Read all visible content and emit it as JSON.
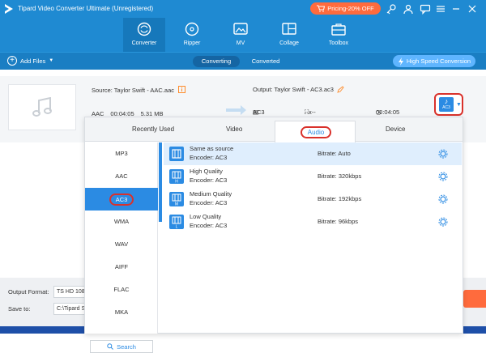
{
  "app": {
    "title": "Tipard Video Converter Ultimate (Unregistered)",
    "promo_label": "Pricing-20% OFF"
  },
  "toolbar": {
    "tools": [
      {
        "label": "Converter",
        "icon": "converter-icon"
      },
      {
        "label": "Ripper",
        "icon": "ripper-icon"
      },
      {
        "label": "MV",
        "icon": "mv-icon"
      },
      {
        "label": "Collage",
        "icon": "collage-icon"
      },
      {
        "label": "Toolbox",
        "icon": "toolbox-icon"
      }
    ]
  },
  "subbar": {
    "add_files": "Add Files",
    "converting": "Converting",
    "converted": "Converted",
    "high_speed": "High Speed Conversion"
  },
  "file": {
    "source": "Source: Taylor Swift - AAC.aac",
    "src_format": "AAC",
    "src_duration": "00:04:05",
    "src_size": "5.31 MB",
    "output": "Output: Taylor Swift - AC3.ac3",
    "out_format": "AC3",
    "out_resolution": "--x--",
    "out_duration": "00:04:05",
    "format_badge": "AC3"
  },
  "dropdown": {
    "tabs": [
      "Recently Used",
      "Video",
      "Audio",
      "Device"
    ],
    "active_tab": "Audio",
    "formats": [
      "MP3",
      "AAC",
      "AC3",
      "WMA",
      "WAV",
      "AIFF",
      "FLAC",
      "MKA"
    ],
    "selected_format": "AC3",
    "search_label": "Search",
    "options": [
      {
        "name": "Same as source",
        "encoder": "Encoder: AC3",
        "bitrate": "Bitrate: Auto",
        "badge": ""
      },
      {
        "name": "High Quality",
        "encoder": "Encoder: AC3",
        "bitrate": "Bitrate: 320kbps",
        "badge": "H"
      },
      {
        "name": "Medium Quality",
        "encoder": "Encoder: AC3",
        "bitrate": "Bitrate: 192kbps",
        "badge": "M"
      },
      {
        "name": "Low Quality",
        "encoder": "Encoder: AC3",
        "bitrate": "Bitrate: 96kbps",
        "badge": "L"
      }
    ]
  },
  "bottom": {
    "output_format_label": "Output Format:",
    "output_format_value": "TS HD 1080",
    "save_to_label": "Save to:",
    "save_to_value": "C:\\Tipard S"
  },
  "colors": {
    "brand_blue": "#1f8ad2",
    "accent_blue": "#2b8be3",
    "highlight_red": "#d9312b",
    "promo_orange": "#ff6b3d"
  }
}
